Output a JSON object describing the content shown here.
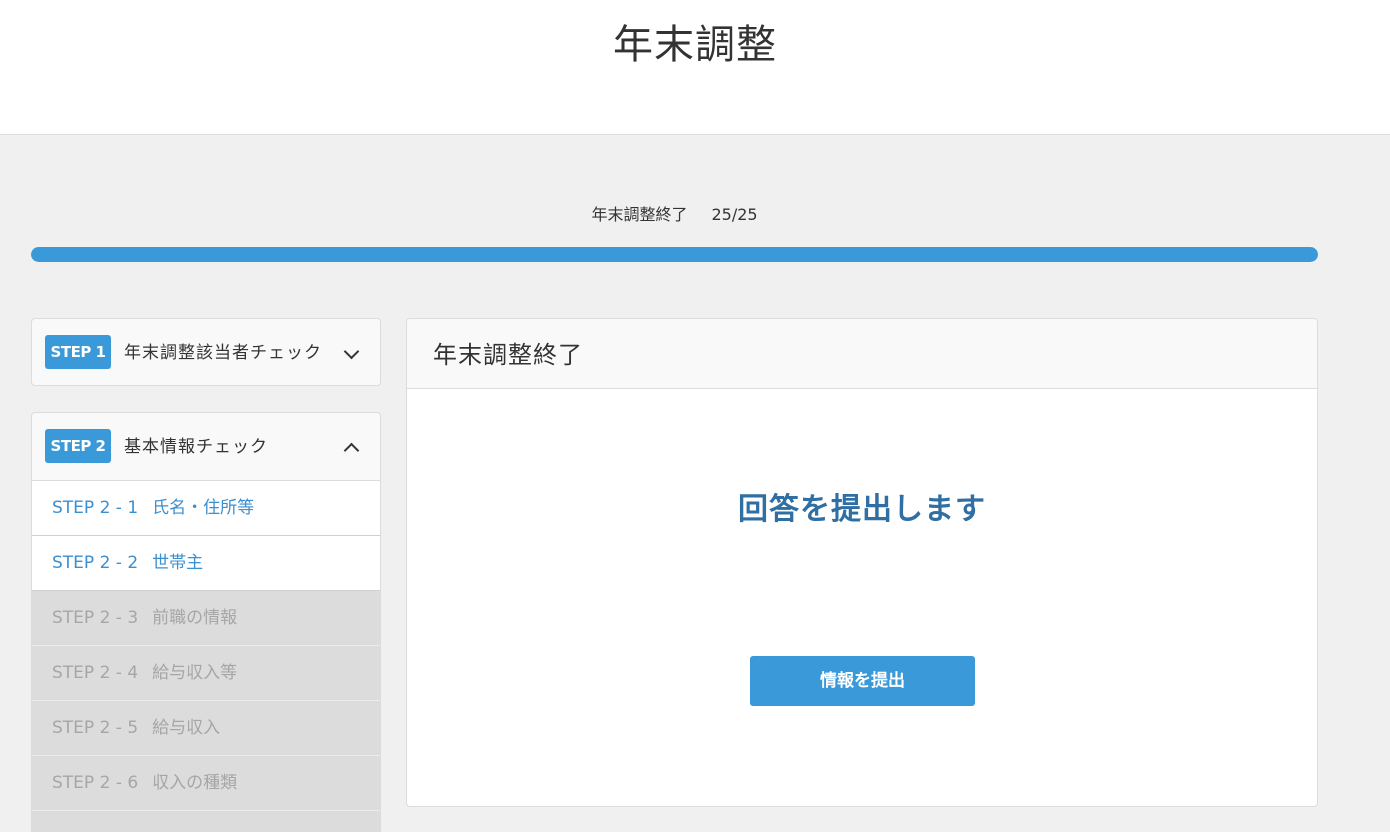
{
  "header": {
    "title": "年末調整"
  },
  "progress": {
    "label": "年末調整終了",
    "count_text": "25/25",
    "current": 25,
    "total": 25,
    "color": "#3a99d8"
  },
  "sidebar": {
    "step1": {
      "badge": "STEP 1",
      "title": "年末調整該当者チェック",
      "expanded": false
    },
    "step2": {
      "badge": "STEP 2",
      "title": "基本情報チェック",
      "expanded": true,
      "items": [
        {
          "code": "STEP 2 - 1",
          "label": "氏名・住所等",
          "state": "active"
        },
        {
          "code": "STEP 2 - 2",
          "label": "世帯主",
          "state": "active"
        },
        {
          "code": "STEP 2 - 3",
          "label": "前職の情報",
          "state": "disabled"
        },
        {
          "code": "STEP 2 - 4",
          "label": "給与収入等",
          "state": "disabled"
        },
        {
          "code": "STEP 2 - 5",
          "label": "給与収入",
          "state": "disabled"
        },
        {
          "code": "STEP 2 - 6",
          "label": "収入の種類",
          "state": "disabled"
        }
      ]
    }
  },
  "main": {
    "title": "年末調整終了",
    "message": "回答を提出します",
    "submit_label": "情報を提出"
  },
  "colors": {
    "accent": "#3a99d8",
    "message": "#2f6fa3",
    "link": "#3a8fd0",
    "disabled_bg": "#dcdcdc",
    "disabled_text": "#a6a6a6"
  },
  "icons": {
    "step1_toggle": "chevron-down-icon",
    "step2_toggle": "chevron-up-icon"
  }
}
